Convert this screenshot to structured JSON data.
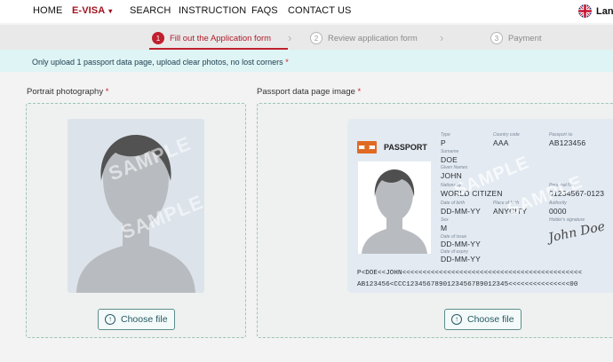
{
  "nav": {
    "items": [
      {
        "label": "HOME"
      },
      {
        "label": "E-VISA",
        "caret": "▾"
      },
      {
        "label": "SEARCH"
      },
      {
        "label": "INSTRUCTION"
      },
      {
        "label": "FAQS"
      },
      {
        "label": "CONTACT US"
      }
    ],
    "language_label": "Lan",
    "language_icon": "uk-flag-icon"
  },
  "stepper": {
    "steps": [
      {
        "number": "1",
        "label": "Fill out the Application form",
        "state": "active"
      },
      {
        "number": "2",
        "label": "Review application form",
        "state": "inactive"
      },
      {
        "number": "3",
        "label": "Payment",
        "state": "inactive"
      }
    ],
    "separator_icon": "chevron-right-icon"
  },
  "notice": {
    "text": "Only upload 1 passport data page, upload clear photos, no lost corners",
    "required_mark": "*"
  },
  "uploads": {
    "portrait": {
      "label": "Portrait photography",
      "required_mark": "*",
      "button_label": "Choose file",
      "watermark": "SAMPLE"
    },
    "passport": {
      "label": "Passport data page image",
      "required_mark": "*",
      "button_label": "Choose file",
      "watermark": "SAMPLE"
    }
  },
  "passport_sample": {
    "title": "PASSPORT",
    "type_label": "Type",
    "type": "P",
    "country_code_label": "Country code",
    "country_code": "AAA",
    "passport_no_label": "Passport №",
    "passport_no": "AB123456",
    "surname_label": "Surname",
    "surname": "DOE",
    "given_names_label": "Given Names",
    "given_names": "JOHN",
    "nationality_label": "Nationality",
    "nationality": "WORLD CITIZEN",
    "personal_no_label": "Personal No.",
    "personal_no": "01234567-0123",
    "dob_label": "Date of birth",
    "dob": "DD-MM-YY",
    "pob_label": "Place of birth",
    "pob": "ANYCITY",
    "authority_label": "Authority",
    "authority": "0000",
    "sex_label": "Sex",
    "sex": "M",
    "signature_label": "Holder's signature",
    "signature": "John Doe",
    "issue_label": "Date of issue",
    "issue": "DD-MM-YY",
    "expiry_label": "Date of expiry",
    "expiry": "DD-MM-YY",
    "mrz_line1": "P<DOE<<JOHN<<<<<<<<<<<<<<<<<<<<<<<<<<<<<<<<<<<<<<<<<<<<",
    "mrz_line2": "AB123456<CCC1234567890123456789012345<<<<<<<<<<<<<<<00"
  },
  "colors": {
    "brand_red": "#c0202e",
    "teal": "#235a63",
    "info_bg": "#dff4f5"
  }
}
